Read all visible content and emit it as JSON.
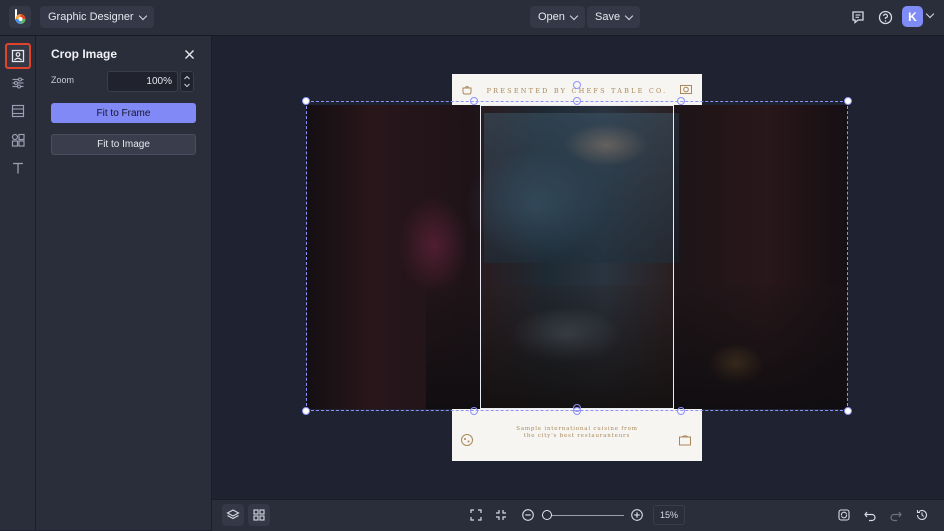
{
  "topbar": {
    "product": "Graphic Designer",
    "open_label": "Open",
    "save_label": "Save",
    "avatar_initial": "K"
  },
  "panel": {
    "title": "Crop Image",
    "zoom_label": "Zoom",
    "zoom_value": "100%",
    "fit_frame_label": "Fit to Frame",
    "fit_image_label": "Fit to Image"
  },
  "document": {
    "header_text": "PRESENTED BY CHEFS TABLE CO.",
    "footer_line1": "Sample international cuisine from",
    "footer_line2": "the city's best restauranteurs"
  },
  "bottombar": {
    "zoom_percent": "15%",
    "zoom_slider_value": 0.0
  },
  "colors": {
    "accent": "#8189f7",
    "active_tool_border": "#e0452c",
    "background": "#1f2230",
    "panel": "#2a2d3a",
    "doc_text": "#a8885a"
  }
}
